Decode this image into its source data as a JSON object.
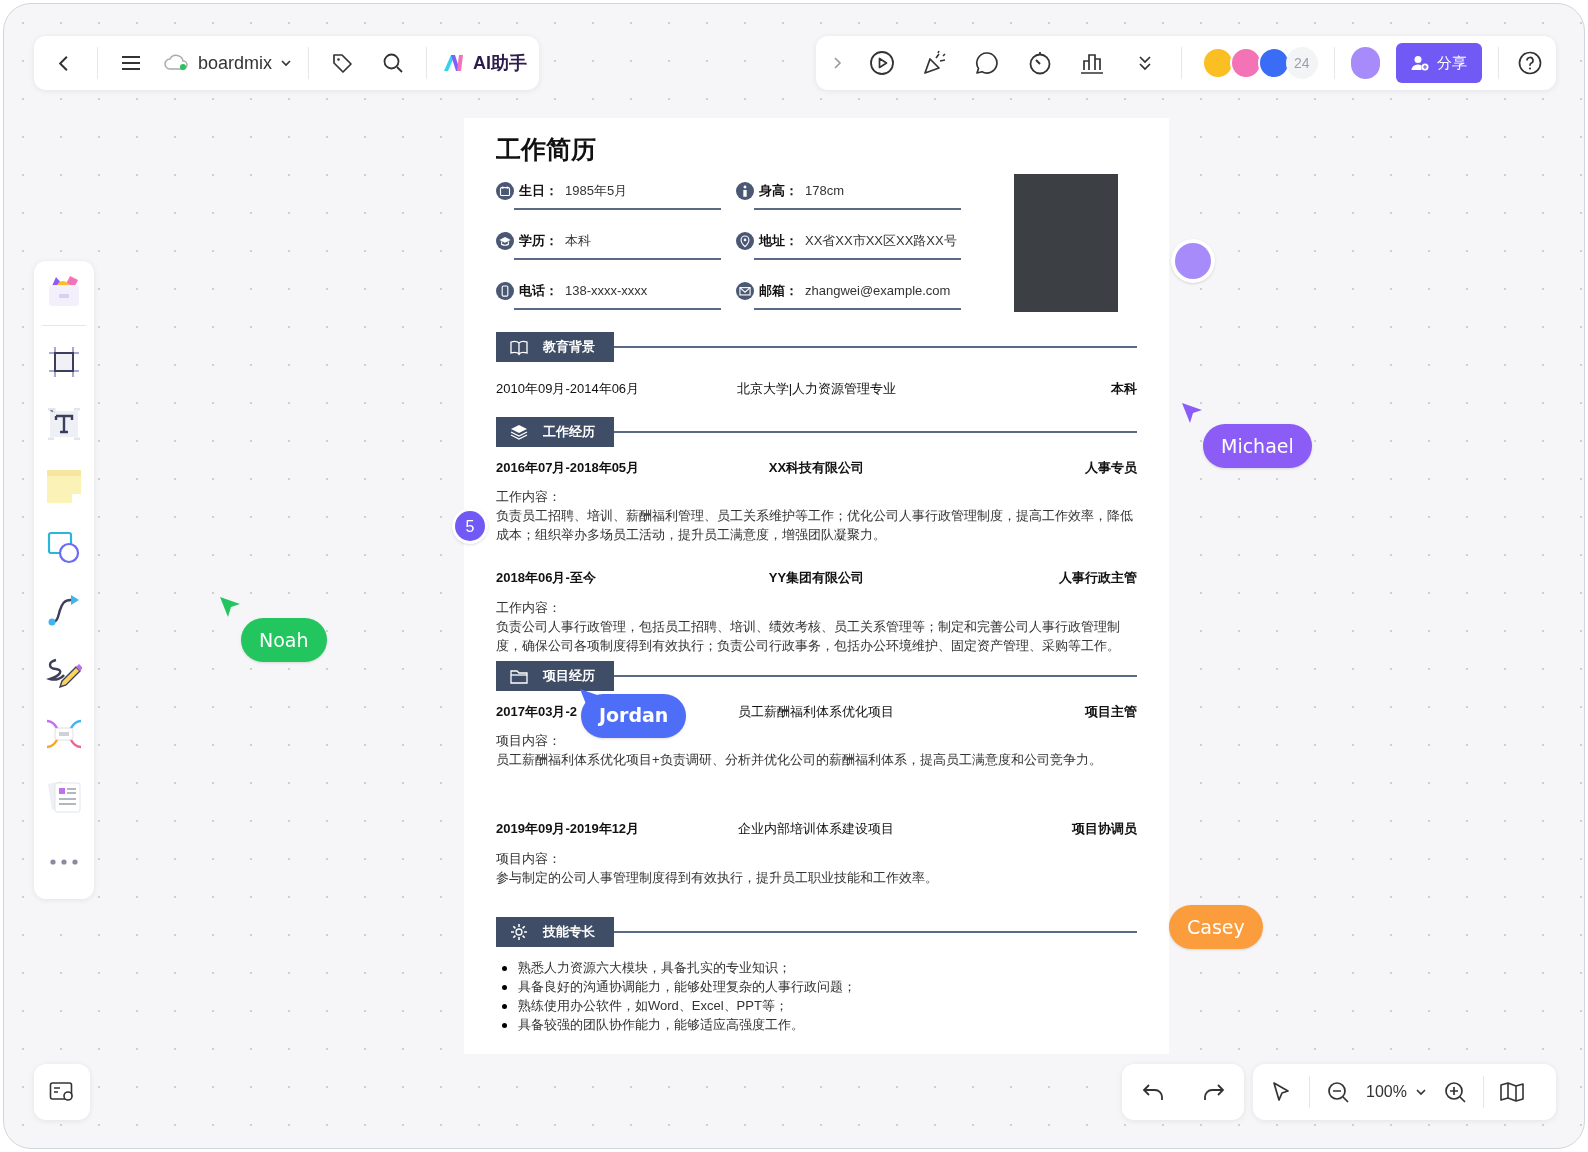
{
  "toolbar_left": {
    "file_name": "boardmix",
    "ai_label": "AI助手"
  },
  "toolbar_right": {
    "collaborator_count": "24",
    "share_label": "分享"
  },
  "resume": {
    "title": "工作简历",
    "info": [
      {
        "kind": "birthday",
        "label": "生日：",
        "value": "1985年5月"
      },
      {
        "kind": "height",
        "label": "身高：",
        "value": "178cm"
      },
      {
        "kind": "education",
        "label": "学历：",
        "value": "本科"
      },
      {
        "kind": "address",
        "label": "地址：",
        "value": "XX省XX市XX区XX路XX号"
      },
      {
        "kind": "phone",
        "label": "电话：",
        "value": "138-xxxx-xxxx"
      },
      {
        "kind": "email",
        "label": "邮箱：",
        "value": "zhangwei@example.com"
      }
    ],
    "sections": [
      {
        "kind": "education",
        "title": "教育背景",
        "entries": [
          {
            "date": "2010年09月-2014年06月",
            "org": "北京大学|人力资源管理专业",
            "role": "本科"
          }
        ]
      },
      {
        "kind": "work",
        "title": "工作经历",
        "entries": [
          {
            "date": "2016年07月-2018年05月",
            "org": "XX科技有限公司",
            "role": "人事专员",
            "content_label": "工作内容：",
            "content": "负责员工招聘、培训、薪酬福利管理、员工关系维护等工作；优化公司人事行政管理制度，提高工作效率，降低成本；组织举办多场员工活动，提升员工满意度，增强团队凝聚力。"
          },
          {
            "date": "2018年06月-至今",
            "org": "YY集团有限公司",
            "role": "人事行政主管",
            "content_label": "工作内容：",
            "content": "负责公司人事行政管理，包括员工招聘、培训、绩效考核、员工关系管理等；制定和完善公司人事行政管理制度，确保公司各项制度得到有效执行；负责公司行政事务，包括办公环境维护、固定资产管理、采购等工作。"
          }
        ]
      },
      {
        "kind": "project",
        "title": "项目经历",
        "entries": [
          {
            "date": "2017年03月-2",
            "org": "员工薪酬福利体系优化项目",
            "role": "项目主管",
            "content_label": "项目内容：",
            "content": "员工薪酬福利体系优化项目+负责调研、分析并优化公司的薪酬福利体系，提高员工满意度和公司竞争力。"
          },
          {
            "date": "2019年09月-2019年12月",
            "org": "企业内部培训体系建设项目",
            "role": "项目协调员",
            "content_label": "项目内容：",
            "content": "参与制定的公司人事管理制度得到有效执行，提升员工职业技能和工作效率。"
          }
        ]
      },
      {
        "kind": "skills",
        "title": "技能专长",
        "items": [
          "熟悉人力资源六大模块，具备扎实的专业知识；",
          "具备良好的沟通协调能力，能够处理复杂的人事行政问题；",
          "熟练使用办公软件，如Word、Excel、PPT等；",
          "具备较强的团队协作能力，能够适应高强度工作。"
        ]
      }
    ]
  },
  "comment_pin": {
    "count": "5"
  },
  "cursors": [
    {
      "name": "Noah",
      "color": "#22c55e"
    },
    {
      "name": "Michael",
      "color": "#8b5cf6"
    },
    {
      "name": "Jordan",
      "color": "#4f6ef7"
    },
    {
      "name": "Casey",
      "color": "#fb9d3c"
    }
  ],
  "zoom": {
    "value": "100%"
  }
}
